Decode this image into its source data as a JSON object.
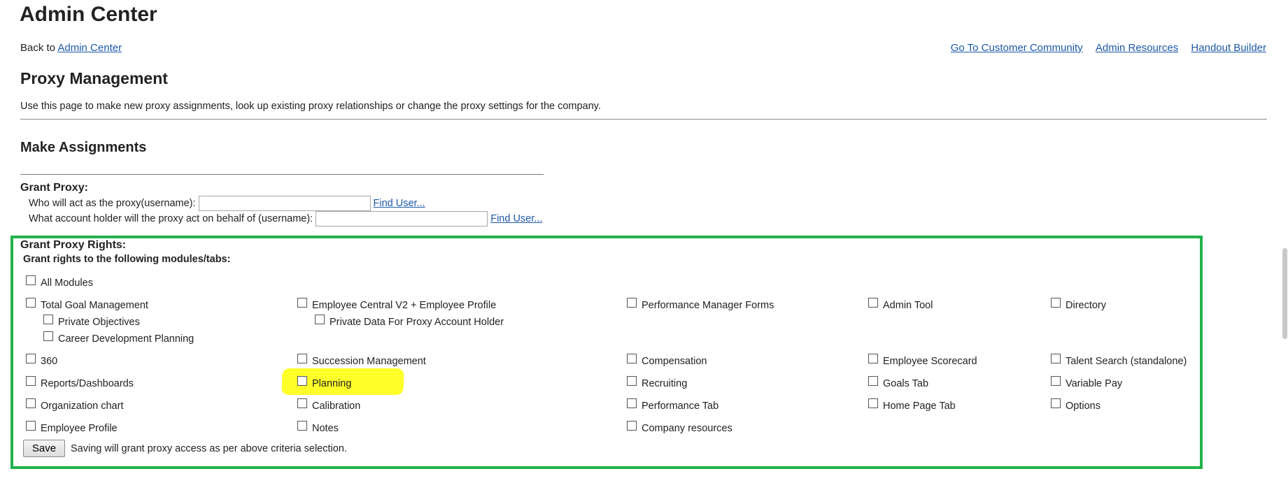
{
  "header": {
    "title": "Admin Center",
    "back_prefix": "Back to",
    "back_link": "Admin Center",
    "links": [
      "Go To Customer Community",
      "Admin Resources",
      "Handout Builder"
    ]
  },
  "page": {
    "heading": "Proxy Management",
    "intro": "Use this page to make new proxy assignments, look up existing proxy relationships or change the proxy settings for the company."
  },
  "make_assignments": {
    "heading": "Make Assignments",
    "grant_proxy_label": "Grant Proxy:",
    "proxy_question": "Who will act as the proxy(username):",
    "holder_question": "What account holder will the proxy act on behalf of (username):",
    "find_user_label": "Find User...",
    "proxy_value": "",
    "holder_value": ""
  },
  "rights": {
    "heading": "Grant Proxy Rights:",
    "subheading": "Grant rights to the following modules/tabs:",
    "all_modules": "All Modules",
    "modules": {
      "total_goal_management": "Total Goal Management",
      "private_objectives": "Private Objectives",
      "career_development_planning": "Career Development Planning",
      "employee_central": "Employee Central V2 + Employee Profile",
      "private_data": "Private Data For Proxy Account Holder",
      "performance_manager_forms": "Performance Manager Forms",
      "admin_tool": "Admin Tool",
      "directory": "Directory",
      "m360": "360",
      "succession_management": "Succession Management",
      "compensation": "Compensation",
      "employee_scorecard": "Employee Scorecard",
      "talent_search": "Talent Search (standalone)",
      "reports_dashboards": "Reports/Dashboards",
      "planning": "Planning",
      "recruiting": "Recruiting",
      "goals_tab": "Goals Tab",
      "variable_pay": "Variable Pay",
      "organization_chart": "Organization chart",
      "calibration": "Calibration",
      "performance_tab": "Performance Tab",
      "home_page_tab": "Home Page Tab",
      "options": "Options",
      "employee_profile": "Employee Profile",
      "notes": "Notes",
      "company_resources": "Company resources"
    },
    "save_label": "Save",
    "save_note": "Saving will grant proxy access as per above criteria selection."
  },
  "colors": {
    "link": "#1d59a8",
    "box_border": "#21b24b",
    "highlight": "#ffff2a"
  }
}
